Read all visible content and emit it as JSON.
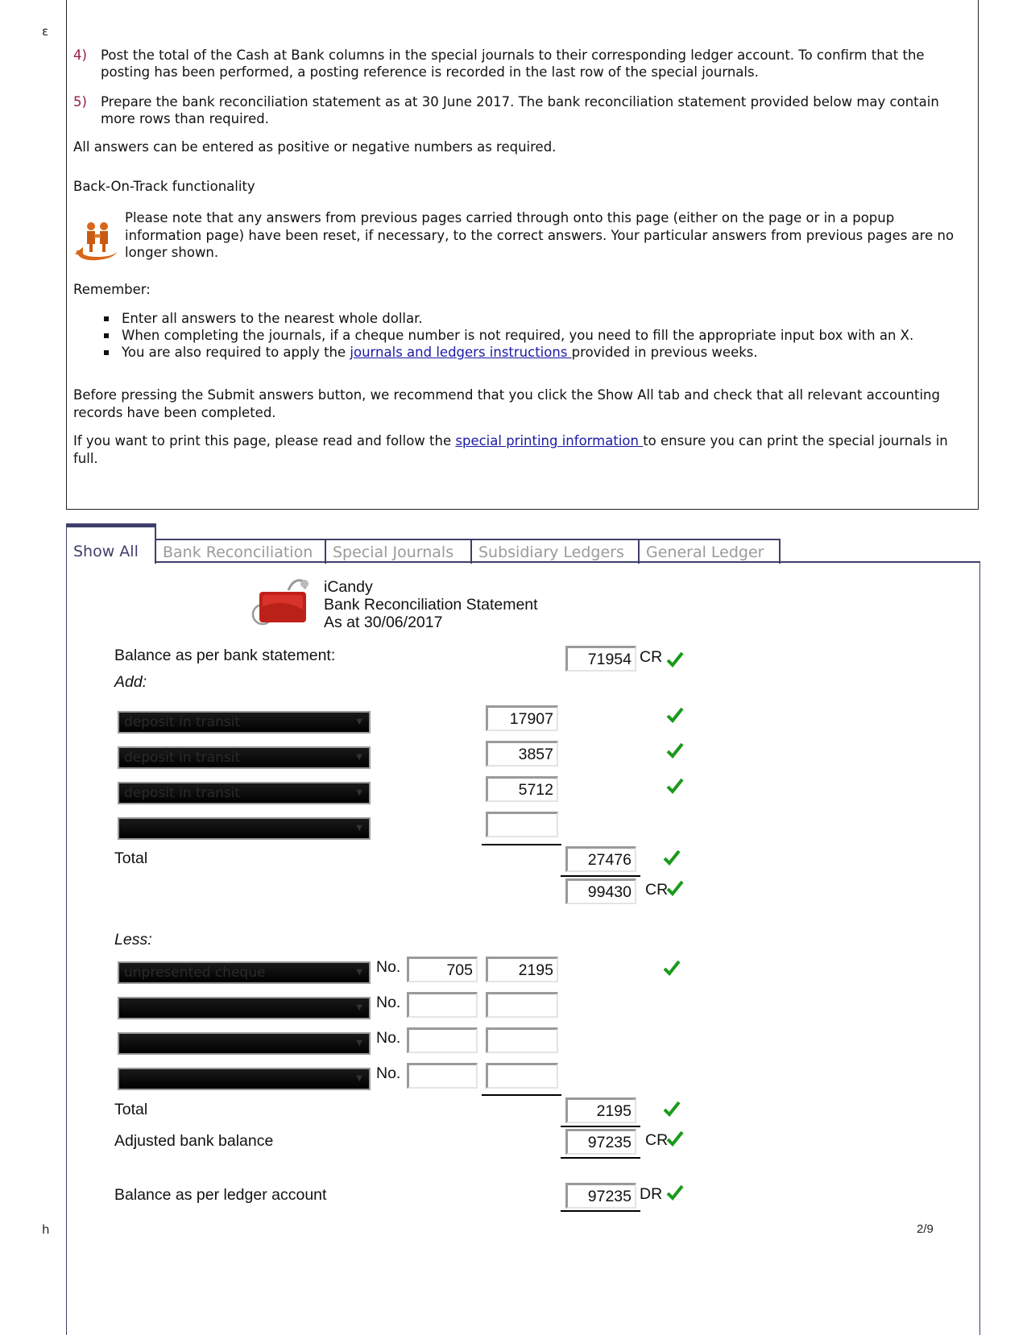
{
  "page_marks": {
    "top_left": "ε",
    "bottom_left": "h",
    "page_number": "2/9"
  },
  "instructions": {
    "steps": [
      {
        "number": "4)",
        "text": "Post the total of the Cash at Bank columns in the special journals to their corresponding ledger account. To confirm that the posting has been performed, a posting reference is recorded in the last row of the special journals."
      },
      {
        "number": "5)",
        "text": "Prepare the bank reconciliation statement as at 30 June 2017. The bank reconciliation statement provided below may contain more rows than required."
      }
    ],
    "answers_note": "All answers can be entered as positive or negative numbers as required.",
    "back_on_track_title": "Back-On-Track functionality",
    "back_on_track_text": "Please note that any answers from previous pages carried through onto this page (either on the page or in a popup information page) have been reset, if necessary, to the correct answers. Your particular answers from previous pages are no longer shown.",
    "remember_label": "Remember:",
    "remember_items": [
      "Enter all answers to the nearest whole dollar.",
      "When completing the journals, if a cheque number is not required, you need to fill the appropriate input box with an X."
    ],
    "remember_item3_pre": "You are also required to apply the ",
    "remember_item3_link": "journals and ledgers instructions ",
    "remember_item3_post": "provided in previous weeks.",
    "submit_note": "Before pressing the Submit answers button, we recommend that you click the Show All tab and check that all relevant accounting records have been completed.",
    "print_pre": "If you want to print this page, please read and follow the ",
    "print_link": "special printing information ",
    "print_post": "to ensure you can print the special journals in full."
  },
  "tabs": [
    {
      "label": "Show All",
      "active": true
    },
    {
      "label": "Bank Reconciliation",
      "active": false
    },
    {
      "label": "Special Journals",
      "active": false
    },
    {
      "label": "Subsidiary Ledgers",
      "active": false
    },
    {
      "label": "General Ledger",
      "active": false
    }
  ],
  "statement": {
    "company": "iCandy",
    "title": "Bank Reconciliation Statement",
    "date": "As at 30/06/2017",
    "bank_balance_label": "Balance as per bank statement:",
    "bank_balance": "71954",
    "bank_balance_side": "CR",
    "add_label": "Add:",
    "add_rows": [
      {
        "type": "deposit in transit",
        "amount": "17907",
        "correct": true
      },
      {
        "type": "deposit in transit",
        "amount": "3857",
        "correct": true
      },
      {
        "type": "deposit in transit",
        "amount": "5712",
        "correct": true
      },
      {
        "type": "",
        "amount": "",
        "correct": false
      }
    ],
    "add_total_label": "Total",
    "add_total": "27476",
    "subtotal": "99430",
    "subtotal_side": "CR",
    "less_label": "Less:",
    "no_label": "No.",
    "less_rows": [
      {
        "type": "unpresented cheque",
        "cheque_no": "705",
        "amount": "2195",
        "correct": true
      },
      {
        "type": "",
        "cheque_no": "",
        "amount": "",
        "correct": false
      },
      {
        "type": "",
        "cheque_no": "",
        "amount": "",
        "correct": false
      },
      {
        "type": "",
        "cheque_no": "",
        "amount": "",
        "correct": false
      }
    ],
    "less_total_label": "Total",
    "less_total": "2195",
    "adjusted_label": "Adjusted bank balance",
    "adjusted_balance": "97235",
    "adjusted_side": "CR",
    "ledger_label": "Balance as per ledger account",
    "ledger_balance": "97235",
    "ledger_side": "DR"
  },
  "colors": {
    "step_number": "#9b1c4a",
    "link": "#1a1aa6",
    "tab_border": "#3f3f6b",
    "tick": "#1a9a1a"
  }
}
